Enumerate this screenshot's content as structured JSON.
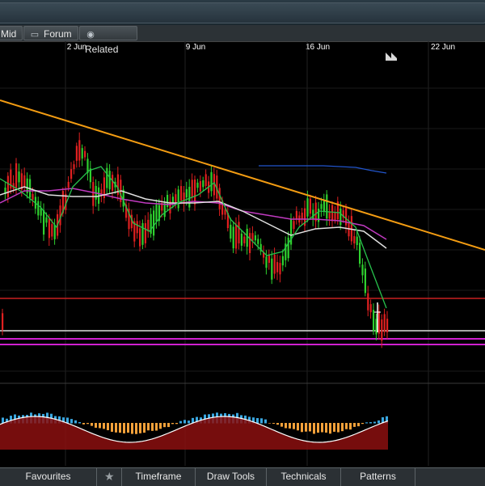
{
  "toolbar": {
    "mid_label": "Mid",
    "forum_label": "Forum",
    "related_label": "Related",
    "forum_icon": "chat-bubble-icon",
    "related_icon": "eye-icon"
  },
  "chart_data": {
    "type": "candlestick",
    "x_ticks": [
      "2 Jun",
      "9 Jun",
      "16 Jun",
      "22 Jun"
    ],
    "indicators": [
      "moving-average-fast",
      "moving-average-mid",
      "moving-average-slow",
      "trendline",
      "support-lines",
      "histogram-oscillator"
    ],
    "colors": {
      "up_candle": "#2fd12f",
      "down_candle": "#e02020",
      "trendline": "#f39c12",
      "ma_fast": "#27c24c",
      "ma_mid": "#c03ac0",
      "ma_slow": "#e0e0e0",
      "ma_long": "#2255cc",
      "support_red": "#c82020",
      "support_white": "#dddddd",
      "support_magenta": "#d020d0",
      "hist_pos": "#3aa7e0",
      "hist_neg": "#f3a13a",
      "osc_fill": "#8b0f0f"
    }
  },
  "bottombar": {
    "favourites": "Favourites",
    "star_icon": "star-icon",
    "timeframe": "Timeframe",
    "draw_tools": "Draw Tools",
    "technicals": "Technicals",
    "patterns": "Patterns"
  }
}
